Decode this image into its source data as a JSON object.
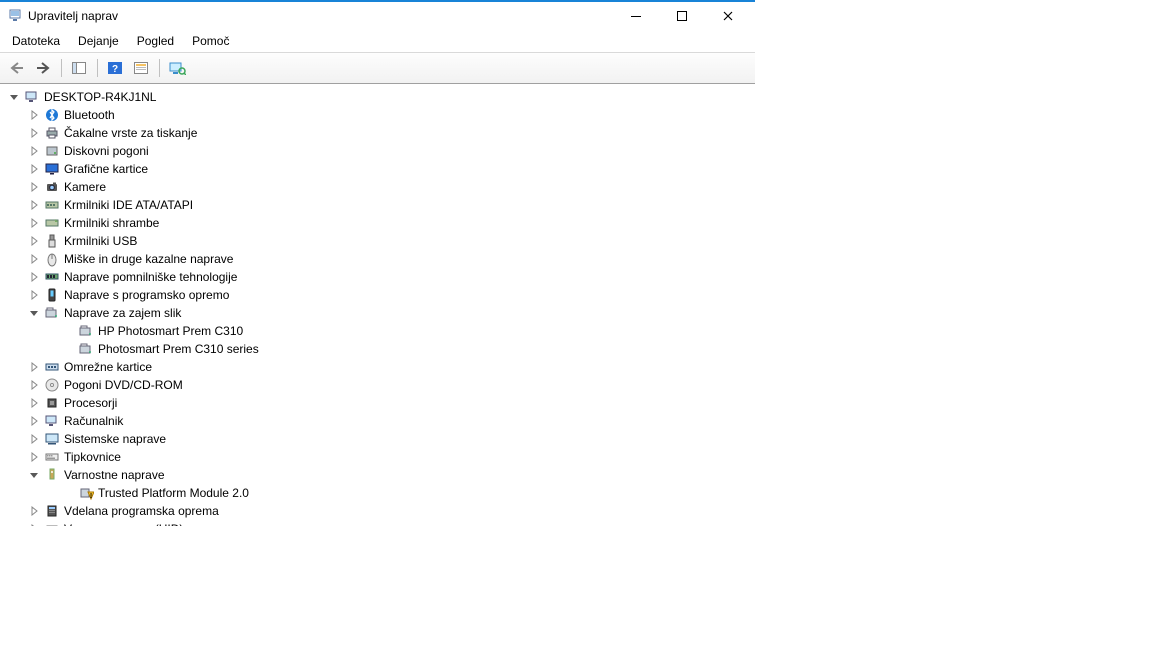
{
  "window": {
    "title": "Upravitelj naprav"
  },
  "menu": {
    "file": "Datoteka",
    "action": "Dejanje",
    "view": "Pogled",
    "help": "Pomoč"
  },
  "tree": {
    "root": "DESKTOP-R4KJ1NL",
    "items": [
      {
        "label": "Bluetooth",
        "icon": "bluetooth",
        "state": "collapsed"
      },
      {
        "label": "Čakalne vrste za tiskanje",
        "icon": "printer",
        "state": "collapsed"
      },
      {
        "label": "Diskovni pogoni",
        "icon": "disk",
        "state": "collapsed"
      },
      {
        "label": "Grafične kartice",
        "icon": "display",
        "state": "collapsed"
      },
      {
        "label": "Kamere",
        "icon": "camera",
        "state": "collapsed"
      },
      {
        "label": "Krmilniki IDE ATA/ATAPI",
        "icon": "ide",
        "state": "collapsed"
      },
      {
        "label": "Krmilniki shrambe",
        "icon": "storage",
        "state": "collapsed"
      },
      {
        "label": "Krmilniki USB",
        "icon": "usb",
        "state": "collapsed"
      },
      {
        "label": "Miške in druge kazalne naprave",
        "icon": "mouse",
        "state": "collapsed"
      },
      {
        "label": "Naprave pomnilniške tehnologije",
        "icon": "memory",
        "state": "collapsed"
      },
      {
        "label": "Naprave s programsko opremo",
        "icon": "software",
        "state": "collapsed"
      },
      {
        "label": "Naprave za zajem slik",
        "icon": "imaging",
        "state": "expanded",
        "children": [
          {
            "label": "HP Photosmart Prem C310",
            "icon": "imaging"
          },
          {
            "label": "Photosmart Prem C310 series",
            "icon": "imaging"
          }
        ]
      },
      {
        "label": "Omrežne kartice",
        "icon": "network",
        "state": "collapsed"
      },
      {
        "label": "Pogoni DVD/CD-ROM",
        "icon": "dvd",
        "state": "collapsed"
      },
      {
        "label": "Procesorji",
        "icon": "cpu",
        "state": "collapsed"
      },
      {
        "label": "Računalnik",
        "icon": "computer",
        "state": "collapsed"
      },
      {
        "label": "Sistemske naprave",
        "icon": "system",
        "state": "collapsed"
      },
      {
        "label": "Tipkovnice",
        "icon": "keyboard",
        "state": "collapsed"
      },
      {
        "label": "Varnostne naprave",
        "icon": "security",
        "state": "expanded",
        "children": [
          {
            "label": "Trusted Platform Module 2.0",
            "icon": "warning"
          }
        ]
      },
      {
        "label": "Vdelana programska oprema",
        "icon": "firmware",
        "state": "collapsed"
      },
      {
        "label": "Vnosne naprave (HID)",
        "icon": "hid",
        "state": "collapsed"
      }
    ]
  }
}
